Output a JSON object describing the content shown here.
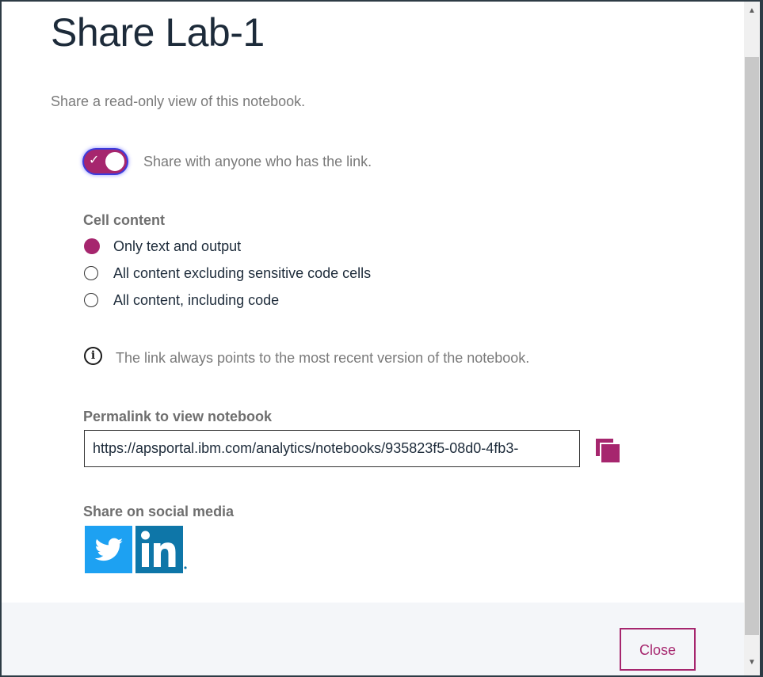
{
  "dialog": {
    "title": "Share Lab-1",
    "subtitle": "Share a read-only view of this notebook."
  },
  "share_toggle": {
    "on": true,
    "label": "Share with anyone who has the link."
  },
  "cell_content": {
    "heading": "Cell content",
    "options": [
      {
        "label": "Only text and output",
        "selected": true
      },
      {
        "label": "All content excluding sensitive code cells",
        "selected": false
      },
      {
        "label": "All content, including code",
        "selected": false
      }
    ]
  },
  "info": {
    "icon": "info-icon",
    "text": "The link always points to the most recent version of the notebook."
  },
  "permalink": {
    "heading": "Permalink to view notebook",
    "value": "https://apsportal.ibm.com/analytics/notebooks/935823f5-08d0-4fb3-",
    "copy_icon": "copy-icon"
  },
  "social": {
    "heading": "Share on social media",
    "items": [
      {
        "name": "twitter-icon",
        "color": "#1da1f2"
      },
      {
        "name": "linkedin-icon",
        "color": "#0e76a8"
      }
    ]
  },
  "footer": {
    "close_label": "Close"
  },
  "colors": {
    "accent": "#a6266e",
    "title": "#1d2b3a",
    "muted": "#7a7a7a"
  }
}
